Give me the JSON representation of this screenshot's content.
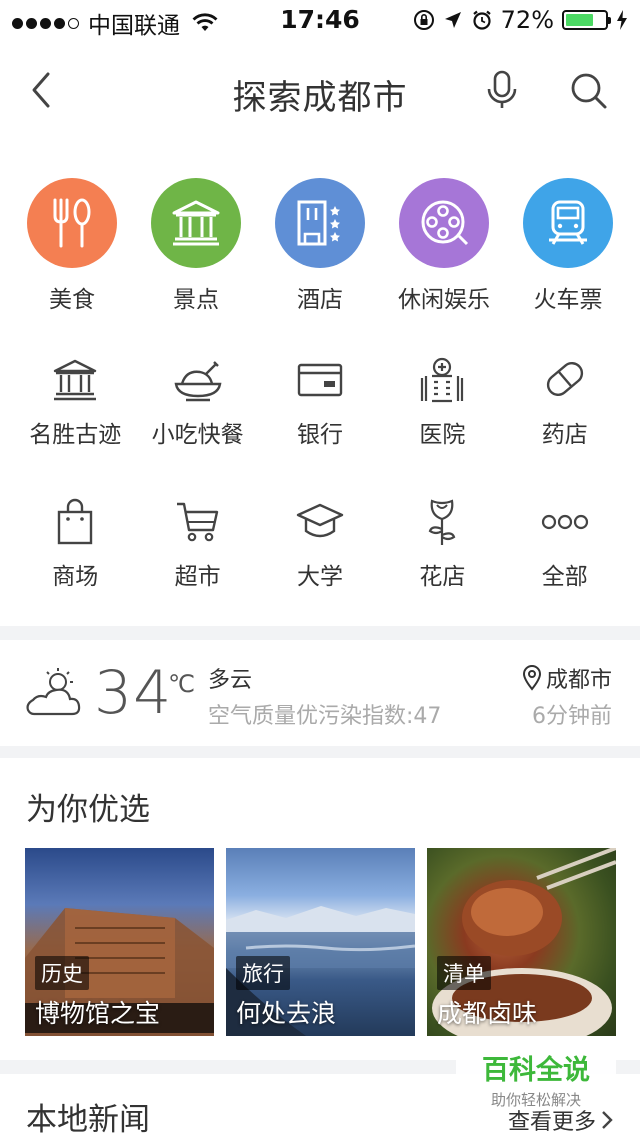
{
  "status_bar": {
    "carrier": "中国联通",
    "time": "17:46",
    "battery": "72%",
    "battery_level": 0.72
  },
  "nav": {
    "title": "探索成都市",
    "icons": [
      "back-icon",
      "microphone-icon",
      "search-icon"
    ]
  },
  "big_categories": [
    {
      "label": "美食",
      "icon": "fork-spoon-icon",
      "color": "#f47f52"
    },
    {
      "label": "景点",
      "icon": "temple-icon",
      "color": "#6fb547"
    },
    {
      "label": "酒店",
      "icon": "hotel-icon",
      "color": "#5f8fd6"
    },
    {
      "label": "休闲娱乐",
      "icon": "film-reel-icon",
      "color": "#a676d7"
    },
    {
      "label": "火车票",
      "icon": "train-icon",
      "color": "#3fa4e8"
    }
  ],
  "small_categories": [
    {
      "label": "名胜古迹",
      "icon": "landmark-icon"
    },
    {
      "label": "小吃快餐",
      "icon": "roast-chicken-icon"
    },
    {
      "label": "银行",
      "icon": "bank-card-icon"
    },
    {
      "label": "医院",
      "icon": "hospital-icon"
    },
    {
      "label": "药店",
      "icon": "pill-icon"
    },
    {
      "label": "商场",
      "icon": "shopping-bag-icon"
    },
    {
      "label": "超市",
      "icon": "cart-icon"
    },
    {
      "label": "大学",
      "icon": "graduation-cap-icon"
    },
    {
      "label": "花店",
      "icon": "rose-icon"
    },
    {
      "label": "全部",
      "icon": "more-icon"
    }
  ],
  "weather": {
    "temperature": "34",
    "unit": "℃",
    "condition": "多云",
    "aqi_text": "空气质量优污染指数:47",
    "city": "成都市",
    "updated": "6分钟前"
  },
  "picks": {
    "title": "为你优选",
    "cards": [
      {
        "tag": "历史",
        "name": "博物馆之宝"
      },
      {
        "tag": "旅行",
        "name": "何处去浪"
      },
      {
        "tag": "清单",
        "name": "成都卤味"
      }
    ]
  },
  "news": {
    "title": "本地新闻",
    "more": "查看更多"
  },
  "watermark": {
    "main": "百科全说",
    "sub": "助你轻松解决"
  }
}
